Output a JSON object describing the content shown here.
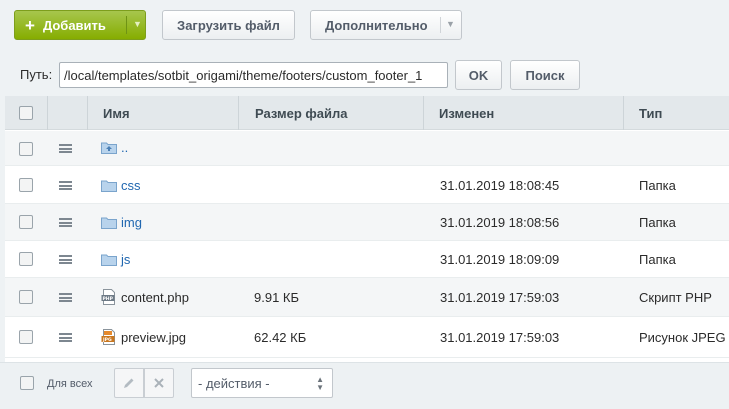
{
  "toolbar": {
    "add_label": "Добавить",
    "upload_label": "Загрузить файл",
    "more_label": "Дополнительно"
  },
  "pathbar": {
    "label": "Путь:",
    "value": "/local/templates/sotbit_origami/theme/footers/custom_footer_1",
    "ok_label": "OK",
    "search_label": "Поиск"
  },
  "grid": {
    "columns": {
      "name": "Имя",
      "size": "Размер файла",
      "modified": "Изменен",
      "type": "Тип"
    },
    "rows": [
      {
        "name": "..",
        "icon": "folder-up-icon",
        "size": "",
        "modified": "",
        "type": ""
      },
      {
        "name": "css",
        "icon": "folder-icon",
        "size": "",
        "modified": "31.01.2019 18:08:45",
        "type": "Папка"
      },
      {
        "name": "img",
        "icon": "folder-icon",
        "size": "",
        "modified": "31.01.2019 18:08:56",
        "type": "Папка"
      },
      {
        "name": "js",
        "icon": "folder-icon",
        "size": "",
        "modified": "31.01.2019 18:09:09",
        "type": "Папка"
      },
      {
        "name": "content.php",
        "icon": "php-file-icon",
        "size": "9.91 КБ",
        "modified": "31.01.2019 17:59:03",
        "type": "Скрипт PHP"
      },
      {
        "name": "preview.jpg",
        "icon": "jpg-file-icon",
        "size": "62.42 КБ",
        "modified": "31.01.2019 17:59:03",
        "type": "Рисунок JPEG"
      }
    ]
  },
  "footer": {
    "all_label": "Для всех",
    "actions_value": "- действия -"
  },
  "colors": {
    "add_button": "#86ad00",
    "link": "#2067b0",
    "header_bg": "#e3e8eb"
  }
}
